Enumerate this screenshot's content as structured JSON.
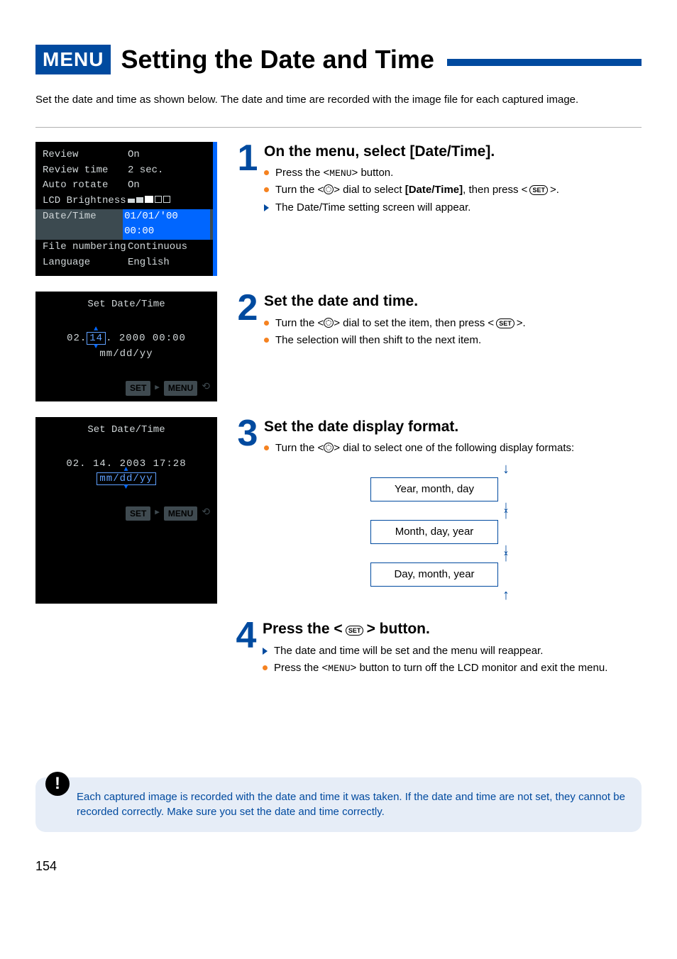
{
  "header": {
    "menu_badge": "MENU",
    "title": "Setting the Date and Time"
  },
  "intro": "Set the date and time as shown below. The date and time are recorded with the image file for each captured image.",
  "lcd_menu": {
    "review": {
      "label": "Review",
      "value": "On"
    },
    "review_time": {
      "label": "Review time",
      "value": "2 sec."
    },
    "auto_rotate": {
      "label": "Auto rotate",
      "value": "On"
    },
    "lcd_brightness": {
      "label": "LCD Brightness"
    },
    "date_time": {
      "label": "Date/Time",
      "value": "01/01/'00 00:00"
    },
    "file_numbering": {
      "label": "File numbering",
      "value": "Continuous"
    },
    "language": {
      "label": "Language",
      "value": "English"
    }
  },
  "lcd_set1": {
    "title": "Set Date/Time",
    "pre": "02.",
    "box": "14",
    "post": ". 2000  00:00  mm/dd/yy",
    "btn_set": "SET",
    "btn_menu": "MENU"
  },
  "lcd_set2": {
    "title": "Set Date/Time",
    "line_pre": "02. 14. 2003  17:28 ",
    "box": "mm/dd/yy",
    "btn_set": "SET",
    "btn_menu": "MENU"
  },
  "steps": {
    "s1": {
      "num": "1",
      "title": "On the menu, select [Date/Time].",
      "b1a": "Press the <",
      "b1b": "> button.",
      "b2a": "Turn the <",
      "b2b": "> dial to select ",
      "b2c": "[Date/Time]",
      "b2d": ", then press < ",
      "b2e": " >.",
      "b3": "The Date/Time setting screen will appear.",
      "menu_word": "MENU",
      "set_word": "SET"
    },
    "s2": {
      "num": "2",
      "title": "Set the date and time.",
      "b1a": "Turn the <",
      "b1b": "> dial to set the item, then press < ",
      "b1c": " >.",
      "b2": "The selection will then shift to the next item.",
      "set_word": "SET"
    },
    "s3": {
      "num": "3",
      "title": "Set the date display format.",
      "b1a": "Turn the <",
      "b1b": "> dial to select one of the following display formats:",
      "fmt1": "Year, month, day",
      "fmt2": "Month, day, year",
      "fmt3": "Day, month, year"
    },
    "s4": {
      "num": "4",
      "title_a": "Press the < ",
      "title_b": " > button.",
      "set_word": "SET",
      "b1": "The date and time will be set and the menu will reappear.",
      "b2a": "Press the <",
      "b2b": "> button to turn off the LCD monitor and exit the menu.",
      "menu_word": "MENU"
    }
  },
  "note": "Each captured image is recorded with the date and time it was taken. If the date and time are not set, they cannot be recorded correctly. Make sure you set the date and time correctly.",
  "page_number": "154"
}
